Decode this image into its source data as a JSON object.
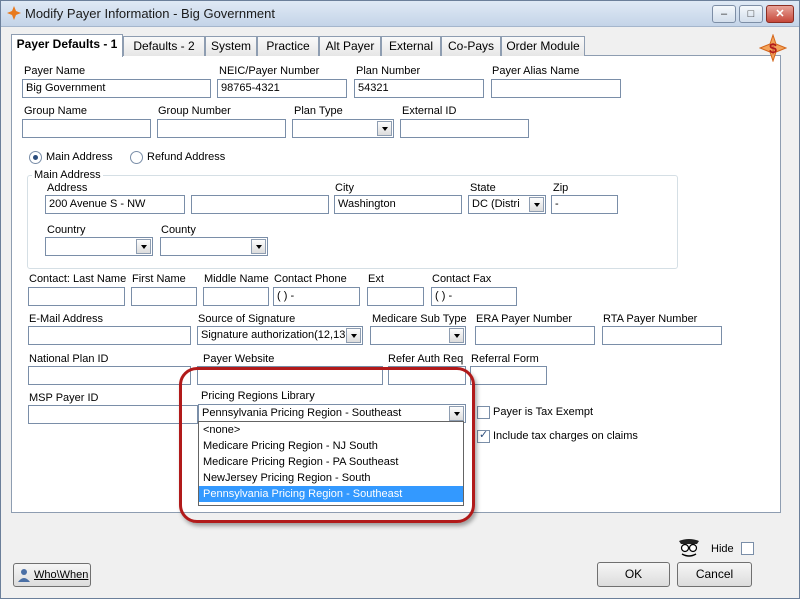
{
  "window": {
    "title": "Modify Payer Information - Big Government",
    "minimize": "‒",
    "maximize": "□",
    "close": "✕"
  },
  "tabs": [
    {
      "label": "Payer Defaults - 1",
      "active": true
    },
    {
      "label": "Defaults - 2"
    },
    {
      "label": "System"
    },
    {
      "label": "Practice"
    },
    {
      "label": "Alt Payer"
    },
    {
      "label": "External"
    },
    {
      "label": "Co-Pays"
    },
    {
      "label": "Order Module"
    }
  ],
  "payer": {
    "name_label": "Payer Name",
    "name": "Big Government",
    "neic_label": "NEIC/Payer Number",
    "neic": "98765-4321",
    "plan_number_label": "Plan Number",
    "plan_number": "54321",
    "alias_label": "Payer Alias Name",
    "alias": ""
  },
  "group": {
    "name_label": "Group Name",
    "number_label": "Group Number",
    "plan_type_label": "Plan Type",
    "external_id_label": "External ID"
  },
  "address_type": {
    "main": "Main Address",
    "refund": "Refund Address"
  },
  "main_address": {
    "group_label": "Main Address",
    "address_label": "Address",
    "address1": "200 Avenue S - NW",
    "address2": "",
    "city_label": "City",
    "city": "Washington",
    "state_label": "State",
    "state": "DC (Distri",
    "zip_label": "Zip",
    "zip": "    -",
    "country_label": "Country",
    "county_label": "County"
  },
  "contact": {
    "last_label": "Contact:  Last Name",
    "first_label": "First Name",
    "middle_label": "Middle Name",
    "phone_label": "Contact Phone",
    "phone": "(   )    -",
    "ext_label": "Ext",
    "fax_label": "Contact Fax",
    "fax": "(   )    -"
  },
  "misc": {
    "email_label": "E-Mail Address",
    "signature_label": "Source of Signature",
    "signature": "Signature authorization(12,13",
    "medicare_sub_label": "Medicare Sub Type",
    "era_label": "ERA Payer Number",
    "rta_label": "RTA Payer Number",
    "npi_label": "National Plan ID",
    "website_label": "Payer Website",
    "refer_auth_label": "Refer Auth Req",
    "referral_form_label": "Referral Form",
    "msp_label": "MSP Payer ID"
  },
  "pricing": {
    "label": "Pricing Regions Library",
    "selected": "Pennsylvania Pricing Region - Southeast",
    "options": [
      "<none>",
      "Medicare Pricing Region - NJ South",
      "Medicare Pricing Region - PA Southeast",
      "NewJersey Pricing Region - South",
      "Pennsylvania Pricing Region - Southeast"
    ]
  },
  "checks": {
    "tax_exempt": "Payer is Tax Exempt",
    "include_tax": "Include tax charges on claims",
    "hide": "Hide"
  },
  "buttons": {
    "whowhen": "Who\\When",
    "ok": "OK",
    "cancel": "Cancel"
  },
  "colors": {
    "accent": "#3399ff",
    "highlight": "#b11a1a"
  }
}
